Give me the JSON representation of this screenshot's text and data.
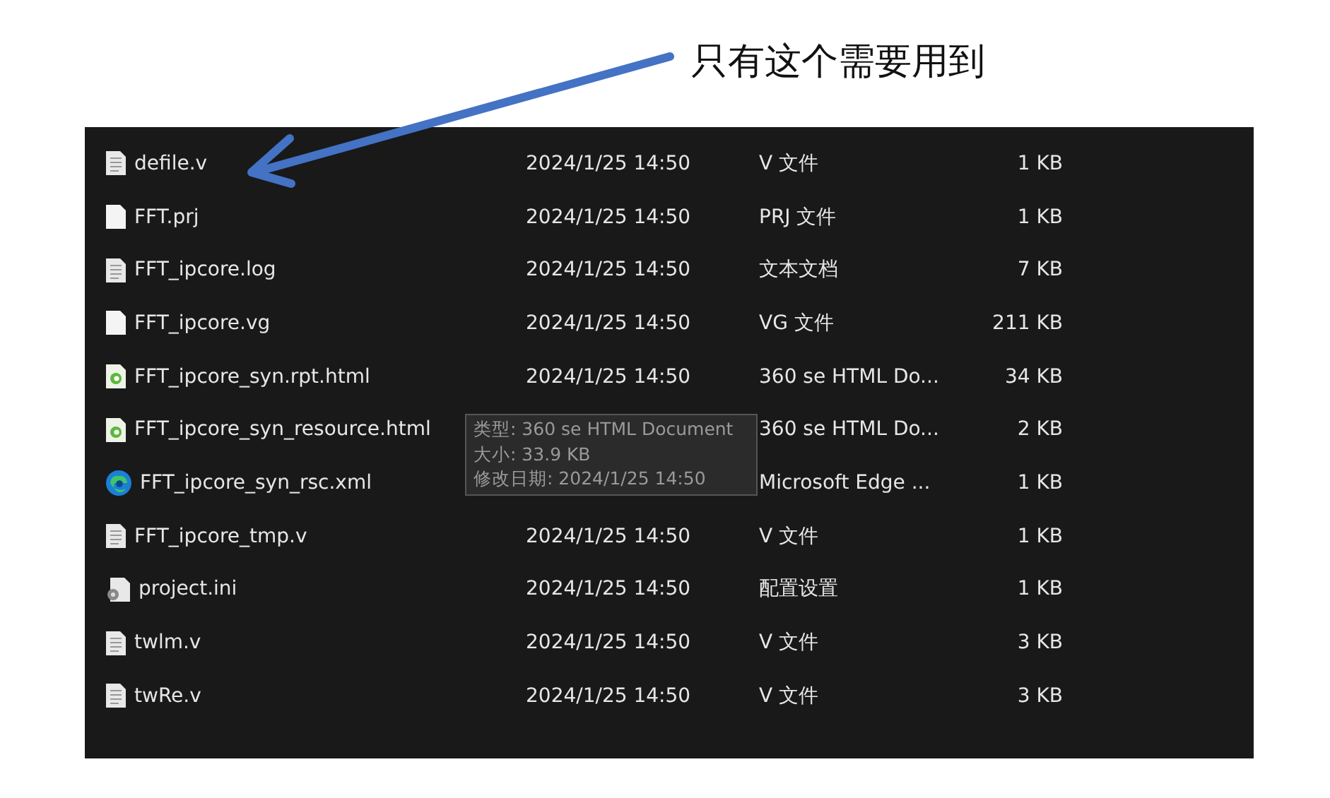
{
  "annotation": {
    "text": "只有这个需要用到"
  },
  "files": [
    {
      "name": "defile.v",
      "kind": "text",
      "date": "2024/1/25 14:50",
      "type": "V 文件",
      "size": "1 KB"
    },
    {
      "name": "FFT.prj",
      "kind": "blank",
      "date": "2024/1/25 14:50",
      "type": "PRJ 文件",
      "size": "1 KB"
    },
    {
      "name": "FFT_ipcore.log",
      "kind": "text",
      "date": "2024/1/25 14:50",
      "type": "文本文档",
      "size": "7 KB"
    },
    {
      "name": "FFT_ipcore.vg",
      "kind": "blank",
      "date": "2024/1/25 14:50",
      "type": "VG 文件",
      "size": "211 KB"
    },
    {
      "name": "FFT_ipcore_syn.rpt.html",
      "kind": "html",
      "date": "2024/1/25 14:50",
      "type": "360 se HTML Do...",
      "size": "34 KB"
    },
    {
      "name": "FFT_ipcore_syn_resource.html",
      "kind": "html",
      "type": "360 se HTML Do...",
      "size": "2 KB"
    },
    {
      "name": "FFT_ipcore_syn_rsc.xml",
      "kind": "edge",
      "type": "Microsoft Edge ...",
      "size": "1 KB"
    },
    {
      "name": "FFT_ipcore_tmp.v",
      "kind": "text",
      "date": "2024/1/25 14:50",
      "type": "V 文件",
      "size": "1 KB"
    },
    {
      "name": "project.ini",
      "kind": "config",
      "date": "2024/1/25 14:50",
      "type": "配置设置",
      "size": "1 KB"
    },
    {
      "name": "twlm.v",
      "kind": "text",
      "date": "2024/1/25 14:50",
      "type": "V 文件",
      "size": "3 KB"
    },
    {
      "name": "twRe.v",
      "kind": "text",
      "date": "2024/1/25 14:50",
      "type": "V 文件",
      "size": "3 KB"
    }
  ],
  "tooltip": {
    "lines": [
      "类型: 360 se HTML Document",
      "大小: 33.9 KB",
      "修改日期: 2024/1/25 14:50"
    ]
  }
}
